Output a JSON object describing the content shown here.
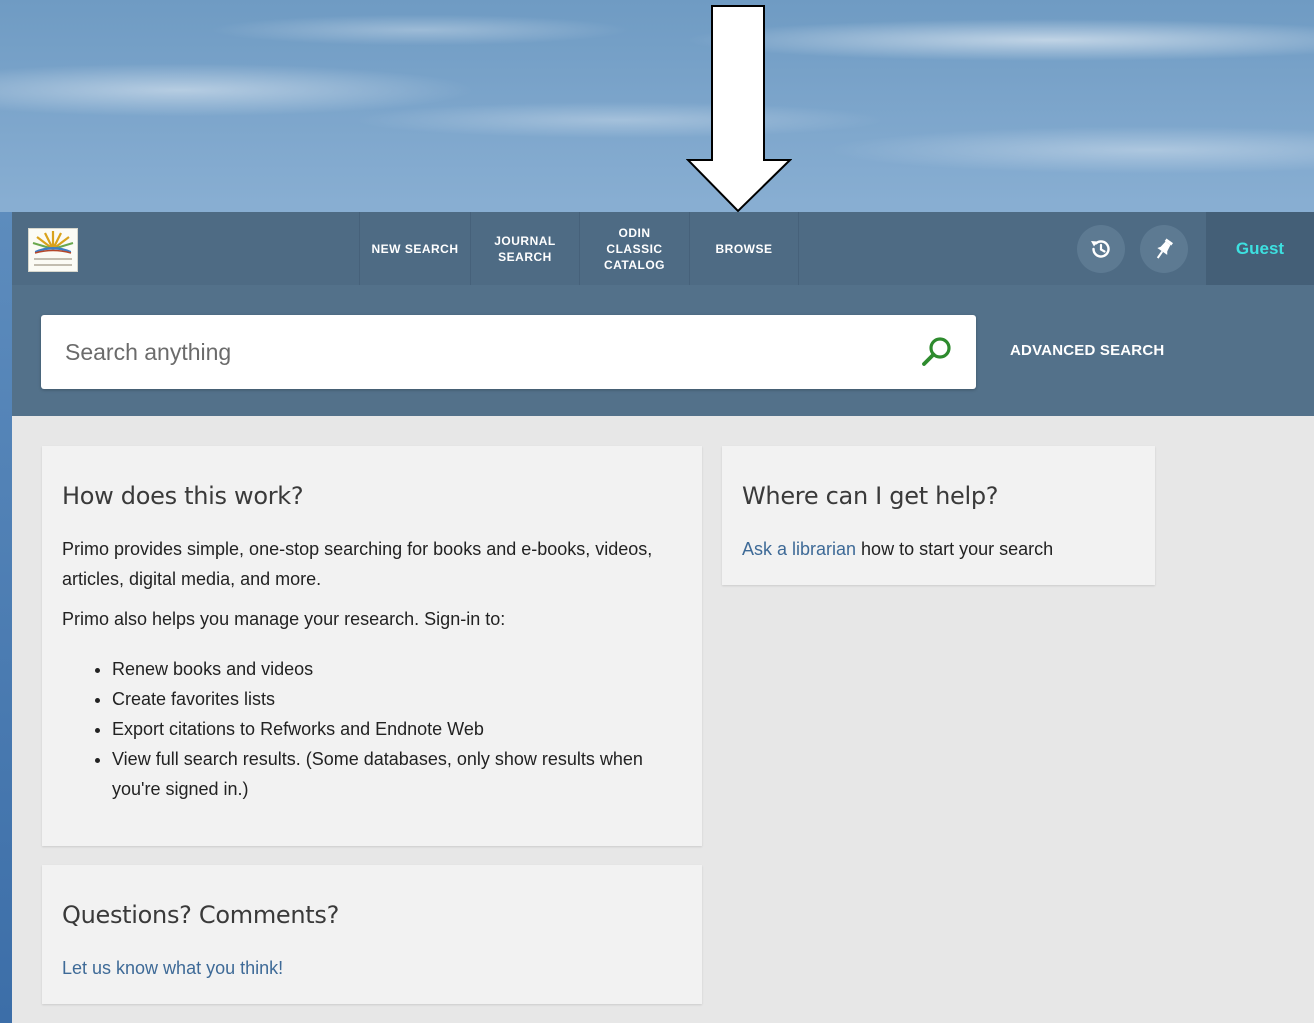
{
  "nav": {
    "items": [
      {
        "label": "NEW SEARCH"
      },
      {
        "label": "JOURNAL\nSEARCH"
      },
      {
        "label": "ODIN\nCLASSIC\nCATALOG"
      },
      {
        "label": "BROWSE"
      }
    ],
    "user_label": "Guest",
    "icons": {
      "history": "history-icon",
      "pin": "pin-icon",
      "logo": "north-dakota-state-library-logo"
    }
  },
  "search": {
    "placeholder": "Search anything",
    "value": "",
    "advanced_label": "ADVANCED SEARCH"
  },
  "cards": {
    "how": {
      "title": "How does this work?",
      "p1": "Primo provides simple, one-stop searching for books and e-books, videos, articles, digital media, and more.",
      "p2": "Primo also helps you manage your research. Sign-in to:",
      "bullets": [
        "Renew books and videos",
        "Create favorites lists",
        "Export citations to Refworks and Endnote Web",
        "View full search results. (Some databases, only show results when you're signed in.)"
      ]
    },
    "help": {
      "title": "Where can I get help?",
      "link": "Ask a librarian",
      "text": " how to start your search"
    },
    "questions": {
      "title": "Questions? Comments?",
      "link": "Let us know what you think!"
    }
  },
  "colors": {
    "topbar": "#4e6b84",
    "searchband": "#53718a",
    "accent_guest": "#3de0e0",
    "search_icon": "#2e8b2e",
    "link": "#3e6a97"
  }
}
